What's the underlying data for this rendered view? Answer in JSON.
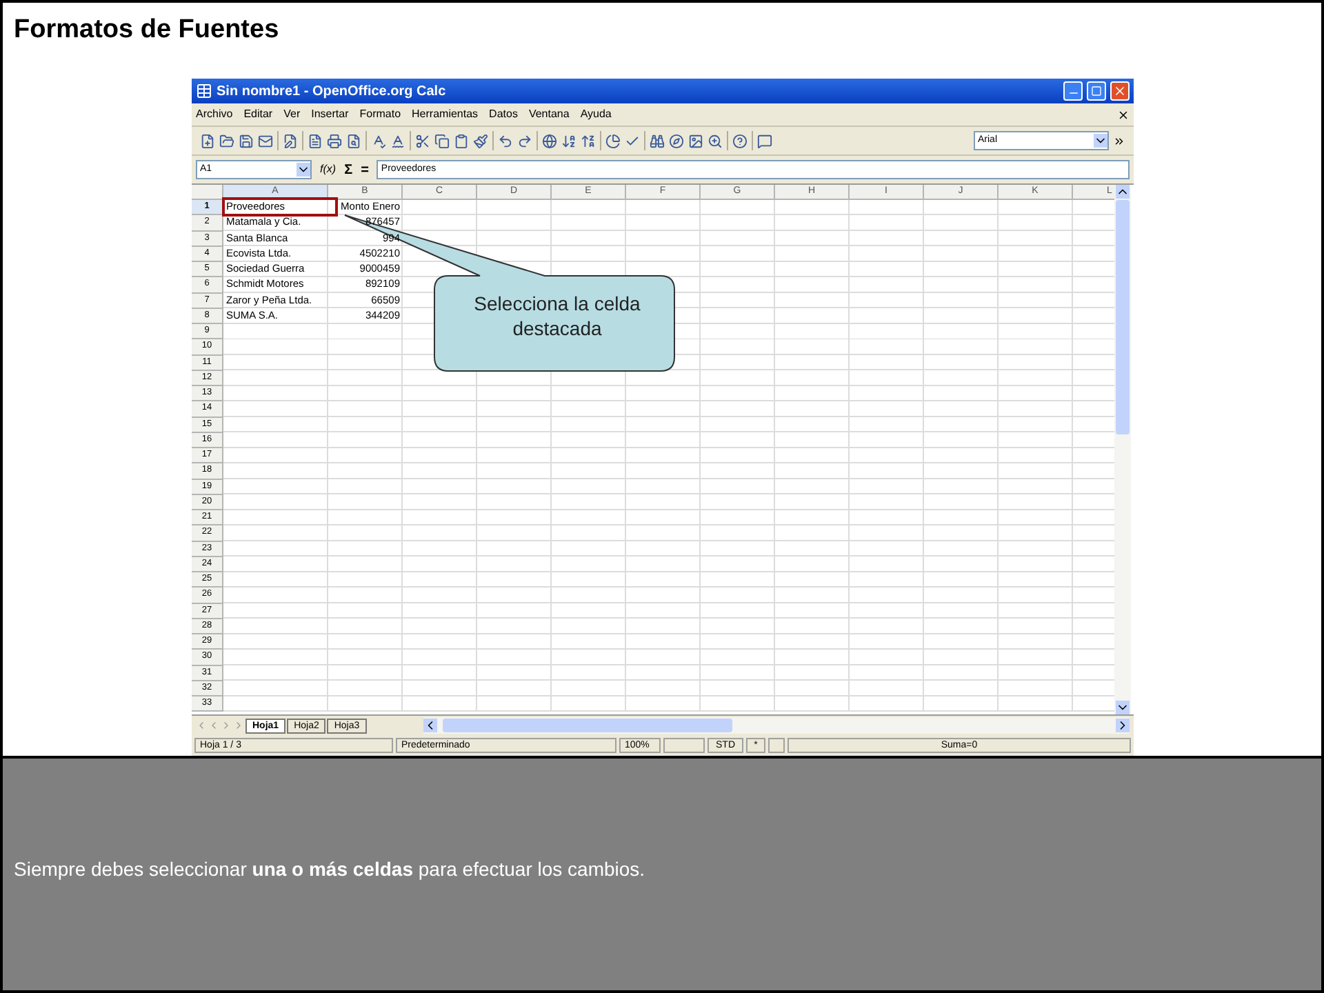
{
  "slide": {
    "title": "Formatos de Fuentes",
    "caption": "Siempre debes seleccionar **una o más celdas** para efectuar los cambios."
  },
  "window": {
    "title": "Sin nombre1 - OpenOffice.org Calc"
  },
  "menu": [
    "Archivo",
    "Editar",
    "Ver",
    "Insertar",
    "Formato",
    "Herramientas",
    "Datos",
    "Ventana",
    "Ayuda"
  ],
  "font_box": {
    "value": "Arial"
  },
  "formula_bar": {
    "name_box": "A1",
    "function_label": "f(x)",
    "sum_label": "Σ",
    "equals_label": "=",
    "value": "Proveedores"
  },
  "columns": [
    {
      "label": "A",
      "selected": true
    },
    {
      "label": "B",
      "selected": false
    },
    {
      "label": "C",
      "selected": false
    },
    {
      "label": "D",
      "selected": false
    },
    {
      "label": "E",
      "selected": false
    },
    {
      "label": "F",
      "selected": false
    },
    {
      "label": "G",
      "selected": false
    },
    {
      "label": "H",
      "selected": false
    },
    {
      "label": "I",
      "selected": false
    },
    {
      "label": "J",
      "selected": false
    },
    {
      "label": "K",
      "selected": false
    },
    {
      "label": "L",
      "selected": false
    }
  ],
  "rows": [
    {
      "number": "1",
      "selected": true,
      "cells": [
        "Proveedores",
        "Monto Enero"
      ]
    },
    {
      "number": "2",
      "selected": false,
      "cells": [
        "Matamala y Cia.",
        "876457"
      ]
    },
    {
      "number": "3",
      "selected": false,
      "cells": [
        "Santa Blanca",
        "994"
      ]
    },
    {
      "number": "4",
      "selected": false,
      "cells": [
        "Ecovista Ltda.",
        "4502210"
      ]
    },
    {
      "number": "5",
      "selected": false,
      "cells": [
        "Sociedad Guerra",
        "9000459"
      ]
    },
    {
      "number": "6",
      "selected": false,
      "cells": [
        "Schmidt Motores",
        "892109"
      ]
    },
    {
      "number": "7",
      "selected": false,
      "cells": [
        "Zaror y Peña Ltda.",
        "66509"
      ]
    },
    {
      "number": "8",
      "selected": false,
      "cells": [
        "SUMA S.A.",
        "344209"
      ]
    },
    {
      "number": "9",
      "selected": false
    },
    {
      "number": "10",
      "selected": false
    },
    {
      "number": "11",
      "selected": false
    },
    {
      "number": "12",
      "selected": false
    },
    {
      "number": "13",
      "selected": false
    },
    {
      "number": "14",
      "selected": false
    },
    {
      "number": "15",
      "selected": false
    },
    {
      "number": "16",
      "selected": false
    },
    {
      "number": "17",
      "selected": false
    },
    {
      "number": "18",
      "selected": false
    },
    {
      "number": "19",
      "selected": false
    },
    {
      "number": "20",
      "selected": false
    },
    {
      "number": "21",
      "selected": false
    },
    {
      "number": "22",
      "selected": false
    },
    {
      "number": "23",
      "selected": false
    },
    {
      "number": "24",
      "selected": false
    },
    {
      "number": "25",
      "selected": false
    },
    {
      "number": "26",
      "selected": false
    },
    {
      "number": "27",
      "selected": false
    },
    {
      "number": "28",
      "selected": false
    },
    {
      "number": "29",
      "selected": false
    },
    {
      "number": "30",
      "selected": false
    },
    {
      "number": "31",
      "selected": false
    },
    {
      "number": "32",
      "selected": false
    },
    {
      "number": "33",
      "selected": false
    }
  ],
  "sheet_tabs": [
    {
      "label": "Hoja1",
      "selected": true
    },
    {
      "label": "Hoja2",
      "selected": false
    },
    {
      "label": "Hoja3",
      "selected": false
    }
  ],
  "status_bar": {
    "sheet": "Hoja 1 / 3",
    "style": "Predeterminado",
    "zoom": "100%",
    "mode": "STD",
    "modified": "*",
    "sum": "Suma=0"
  },
  "callout": {
    "text": "Selecciona la celda destacada"
  }
}
